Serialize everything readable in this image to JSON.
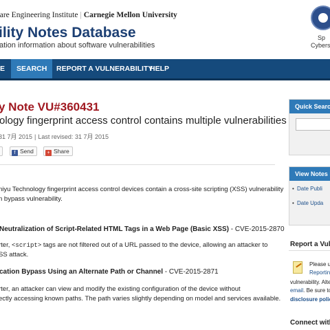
{
  "header": {
    "sei": "vare Engineering Institute",
    "separator": "|",
    "cmu": "Carnegie Mellon University",
    "title": "ility Notes Database",
    "subtitle": "ation information about software vulnerabilities",
    "dhs_line1": "Sp",
    "dhs_line2": "Cybers"
  },
  "nav": {
    "items": [
      {
        "label": "E",
        "active": false
      },
      {
        "label": "SEARCH",
        "active": true
      },
      {
        "label": "REPORT A VULNERABILITY",
        "active": false
      },
      {
        "label": "HELP",
        "active": false
      }
    ]
  },
  "note": {
    "title": "y Note VU#360431",
    "subtitle": "ology fingerprint access control contains multiple vulnerabilities",
    "original_release": "31 7月 2015",
    "last_revised_label": "Last revised:",
    "last_revised": "31 7月 2015",
    "share": {
      "tweet_label": "",
      "fb_label": "Send",
      "gp_label": "Share"
    },
    "overview_line1": "niyu Technology fingerprint access control devices contain a cross-site scripting (XSS) vulnerability",
    "overview_line2": "n bypass vulnerability.",
    "vuln1": {
      "heading": "Neutralization of Script-Related HTML Tags in a Web Page (Basic XSS)",
      "cve": " - CVE-2015-2870",
      "line1_pre": "rter, ",
      "line1_code": "<script>",
      "line1_post": " tags are not filtered out of a URL passed to the device, allowing an attacker to",
      "line2": "SS attack."
    },
    "vuln2": {
      "heading": "cation Bypass Using an Alternate Path or Channel",
      "cve": " - CVE-2015-2871",
      "line1": "rter, an attacker can view and modify the existing configuration of the device without",
      "line2": "ectly accessing known paths. The path varies slightly depending on model and services available."
    }
  },
  "sidebar": {
    "quick_search": "Quick Search",
    "view_notes": "View Notes B",
    "date_published": "Date Publi",
    "date_updated": "Date Upda",
    "report_title": "Report a Vuln",
    "report_please": "Please u",
    "report_reporting": "Reporting",
    "report_vuln": "vulnerability. Alte",
    "report_email": "email",
    "report_besure": ". Be sure to",
    "report_policy": "disclosure policy",
    "connect_title": "Connect with"
  },
  "colors": {
    "nav": "#154a7c",
    "nav_active": "#2f7ab8",
    "vu_title": "#a01820",
    "db_title": "#1c3f73"
  }
}
